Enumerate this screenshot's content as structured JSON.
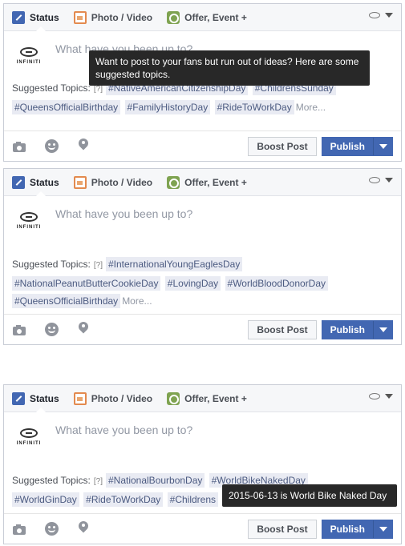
{
  "tabs": {
    "status": "Status",
    "photo_video": "Photo / Video",
    "offer_event": "Offer, Event +"
  },
  "composer": {
    "prompt": "What have you been up to?",
    "brand": "INFINITI"
  },
  "suggested_label": "Suggested Topics:",
  "help_marker": "[?]",
  "more_label": "More...",
  "panels": [
    {
      "tags": [
        "#NativeAmericanCitizenshipDay",
        "#ChildrensSunday",
        "#QueensOfficialBirthday",
        "#FamilyHistoryDay",
        "#RideToWorkDay"
      ]
    },
    {
      "tags": [
        "#InternationalYoungEaglesDay",
        "#NationalPeanutButterCookieDay",
        "#LovingDay",
        "#WorldBloodDonorDay",
        "#QueensOfficialBirthday"
      ]
    },
    {
      "tags": [
        "#NationalBourbonDay",
        "#WorldBikeNakedDay",
        "#WorldGinDay",
        "#RideToWorkDay",
        "#Childrens"
      ]
    }
  ],
  "buttons": {
    "boost": "Boost Post",
    "publish": "Publish"
  },
  "tooltips": {
    "help": "Want to post to your fans but run out of ideas? Here are some suggested topics.",
    "tag_date": "2015-06-13 is World Bike Naked Day"
  },
  "icons": [
    "pencil-icon",
    "photo-icon",
    "offer-icon",
    "page-logo-icon",
    "chevron-down-icon",
    "camera-icon",
    "smiley-icon",
    "location-pin-icon"
  ],
  "colors": {
    "accent": "#4267b2",
    "tag_bg": "#e9ebf3",
    "tag_text": "#4b5a80",
    "tooltip_bg": "#282828"
  }
}
